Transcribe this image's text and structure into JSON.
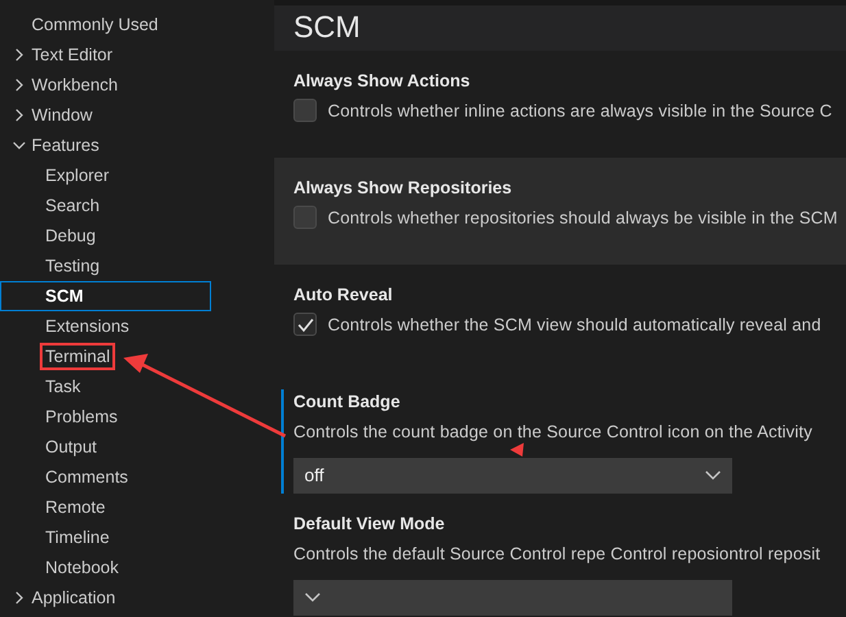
{
  "sidebar": {
    "items": [
      {
        "label": "Commonly Used",
        "kind": "leaf",
        "selected": false,
        "annotated": false
      },
      {
        "label": "Text Editor",
        "kind": "group",
        "expanded": false,
        "selected": false
      },
      {
        "label": "Workbench",
        "kind": "group",
        "expanded": false,
        "selected": false
      },
      {
        "label": "Window",
        "kind": "group",
        "expanded": false,
        "selected": false
      },
      {
        "label": "Features",
        "kind": "group",
        "expanded": true,
        "selected": false,
        "children": [
          {
            "label": "Explorer",
            "kind": "leaf",
            "selected": false,
            "annotated": false
          },
          {
            "label": "Search",
            "kind": "leaf",
            "selected": false,
            "annotated": false
          },
          {
            "label": "Debug",
            "kind": "leaf",
            "selected": false,
            "annotated": false
          },
          {
            "label": "Testing",
            "kind": "leaf",
            "selected": false,
            "annotated": false
          },
          {
            "label": "SCM",
            "kind": "leaf",
            "selected": true,
            "annotated": false
          },
          {
            "label": "Extensions",
            "kind": "leaf",
            "selected": false,
            "annotated": false
          },
          {
            "label": "Terminal",
            "kind": "leaf",
            "selected": false,
            "annotated": true
          },
          {
            "label": "Task",
            "kind": "leaf",
            "selected": false,
            "annotated": false
          },
          {
            "label": "Problems",
            "kind": "leaf",
            "selected": false,
            "annotated": false
          },
          {
            "label": "Output",
            "kind": "leaf",
            "selected": false,
            "annotated": false
          },
          {
            "label": "Comments",
            "kind": "leaf",
            "selected": false,
            "annotated": false
          },
          {
            "label": "Remote",
            "kind": "leaf",
            "selected": false,
            "annotated": false
          },
          {
            "label": "Timeline",
            "kind": "leaf",
            "selected": false,
            "annotated": false
          },
          {
            "label": "Notebook",
            "kind": "leaf",
            "selected": false,
            "annotated": false
          }
        ]
      },
      {
        "label": "Application",
        "kind": "group",
        "expanded": false,
        "selected": false
      }
    ]
  },
  "section_title": "SCM",
  "settings": [
    {
      "title": "Always Show Actions",
      "description": "Controls whether inline actions are always visible in the Source C",
      "kind": "checkbox",
      "checked": false,
      "hovered": false,
      "focused": false
    },
    {
      "title": "Always Show Repositories",
      "description": "Controls whether repositories should always be visible in the SCM",
      "kind": "checkbox",
      "checked": false,
      "hovered": true,
      "focused": false
    },
    {
      "title": "Auto Reveal",
      "description": "Controls whether the SCM view should automatically reveal and",
      "kind": "checkbox",
      "checked": true,
      "hovered": false,
      "focused": false
    },
    {
      "title": "Count Badge",
      "description": "Controls the count badge on the Source Control icon on the Activity",
      "kind": "select",
      "value": "off",
      "hovered": false,
      "focused": true
    },
    {
      "title": "Default View Mode",
      "description": "Controls the default Source Control repe Control reposiontrol reposit",
      "kind": "select",
      "hovered": false,
      "focused": false
    }
  ]
}
